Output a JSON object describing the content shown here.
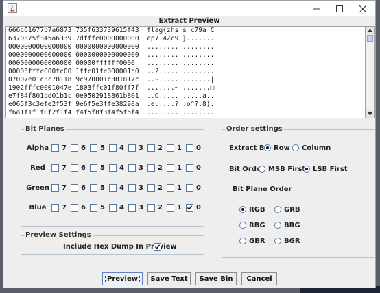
{
  "window": {
    "title": "Extract Preview"
  },
  "preview_lines": [
    "666c61677b7a6873 735f633739615f43  flag{zhs s_c79a_C",
    "6370375f345a6339 7dfffe0000000000  cp7_4Zc9 }.......",
    "0000000000000000 0000000000000000  ........ ........",
    "0000000000000000 0000000000000000  ........ ........",
    "0000000000000000 00000ffffff0000   ........ ........",
    "00003fffc000fc00 1ffc01fe000001c0  ..?..... ........",
    "07007e01c3c78118 9c970001c381817c  ..~..... .......|",
    "1902fffc0001047e 1803ffc01f80ff7f  .......~ .......□",
    "e7f84f801bd01b1c 0e0502918861b801  ..O..... .....a..",
    "e065f3c3efe2f53f 9e6f5e3ffe38298a  .e.....? .o^?.8).",
    "f6a1f1f1f0f2f1f4 f4f5f8f3f4f5f6f4  ........ ........"
  ],
  "bit_planes": {
    "title": "Bit Planes",
    "bits": [
      "7",
      "6",
      "5",
      "4",
      "3",
      "2",
      "1",
      "0"
    ],
    "rows": [
      {
        "label": "Alpha",
        "checked": []
      },
      {
        "label": "Red",
        "checked": []
      },
      {
        "label": "Green",
        "checked": []
      },
      {
        "label": "Blue",
        "checked": [
          "0"
        ]
      }
    ]
  },
  "preview_settings": {
    "title": "Preview Settings",
    "hex_dump_label": "Include Hex Dump In Preview",
    "hex_dump_checked": true
  },
  "order_settings": {
    "title": "Order settings",
    "extract_by": {
      "label": "Extract By",
      "options": [
        "Row",
        "Column"
      ],
      "selected": "Row"
    },
    "bit_order": {
      "label": "Bit Order",
      "options": [
        "MSB First",
        "LSB First"
      ],
      "selected": "LSB First"
    },
    "bit_plane_order": {
      "label": "Bit Plane Order",
      "options": [
        "RGB",
        "GRB",
        "RBG",
        "BRG",
        "GBR",
        "BGR"
      ],
      "selected": "RGB"
    }
  },
  "buttons": {
    "preview": "Preview",
    "save_text": "Save Text",
    "save_bin": "Save Bin",
    "cancel": "Cancel"
  }
}
